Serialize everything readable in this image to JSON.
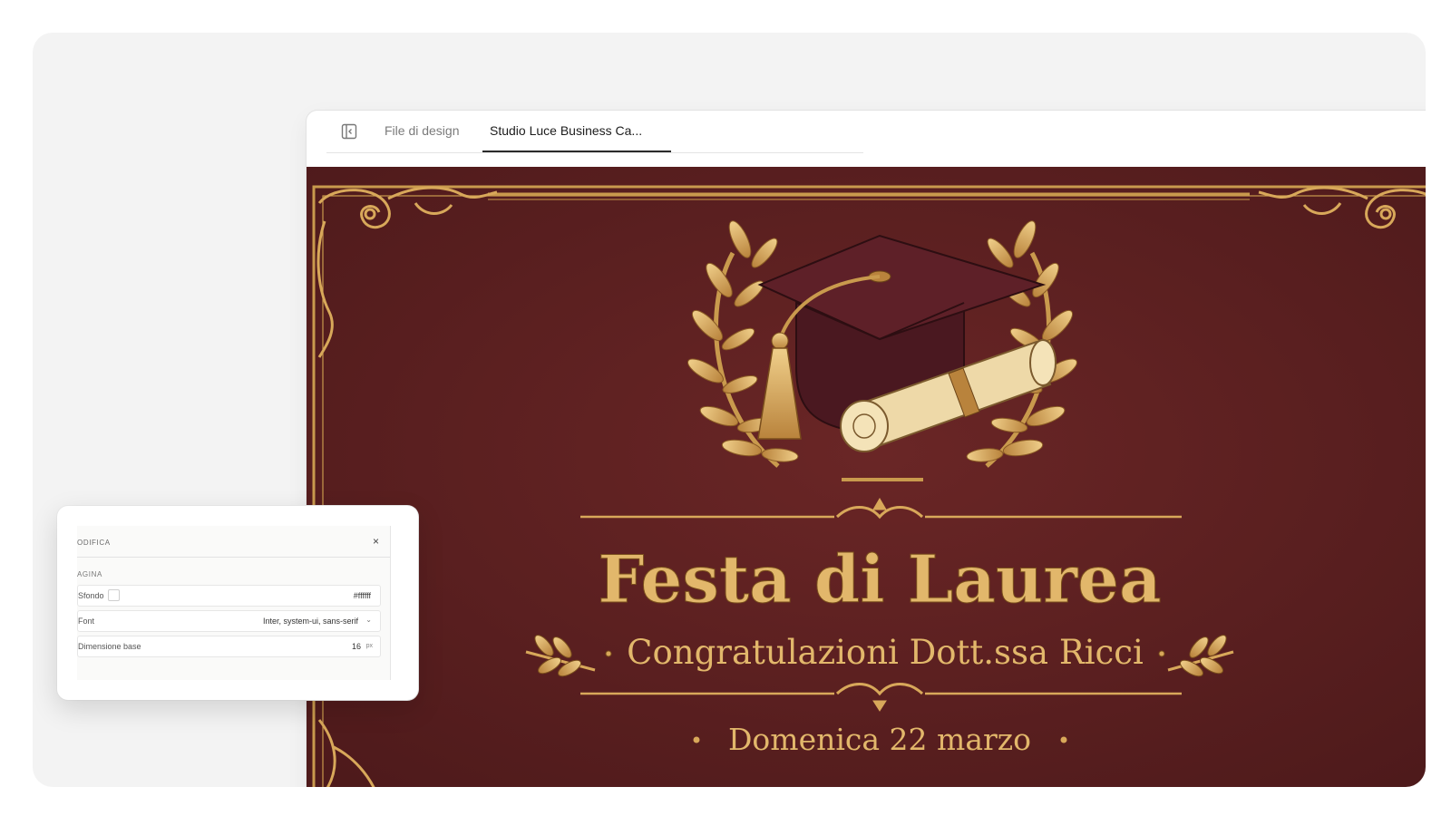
{
  "tabs": [
    {
      "label": "File di design"
    },
    {
      "label": "Studio Luce Business Ca..."
    }
  ],
  "card": {
    "title": "Festa di Laurea",
    "subtitle": "Congratulazioni Dott.ssa Ricci",
    "date": "Domenica 22 marzo",
    "colors": {
      "background": "#5b2020",
      "gold": "#d8a85a",
      "cream": "#eed9a8"
    }
  },
  "panel": {
    "title": "ODIFICA",
    "close": "×",
    "section": "AGINA",
    "rows": [
      {
        "label": "Sfondo",
        "value": "#ffffff"
      },
      {
        "label": "Font",
        "value": "Inter, system-ui, sans-serif"
      },
      {
        "label": "Dimensione base",
        "value": "16",
        "unit": "px"
      }
    ]
  },
  "icons": {
    "sidebar_toggle": "sidebar-toggle-icon",
    "close": "close-icon",
    "chevron": "chevron-down-icon"
  }
}
